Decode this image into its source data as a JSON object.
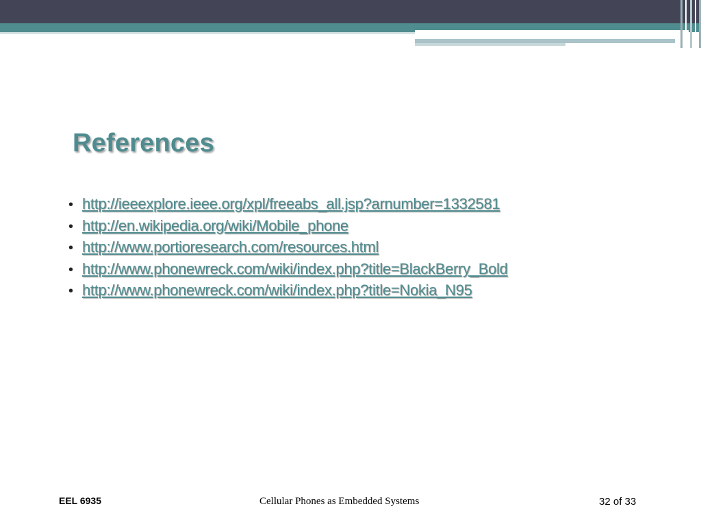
{
  "slide": {
    "title": "References",
    "references": [
      "http://ieeexplore.ieee.org/xpl/freeabs_all.jsp?arnumber=1332581",
      "http://en.wikipedia.org/wiki/Mobile_phone",
      "http://www.portioresearch.com/resources.html",
      "http://www.phonewreck.com/wiki/index.php?title=BlackBerry_Bold",
      "http://www.phonewreck.com/wiki/index.php?title=Nokia_N95"
    ],
    "bullet": "•"
  },
  "footer": {
    "course": "EEL 6935",
    "presentation_title": "Cellular Phones as Embedded Systems",
    "page_indicator": "32 of 33"
  },
  "colors": {
    "accent": "#4f8c8f",
    "banner_dark": "#434557",
    "banner_light": "#a9c3c8"
  }
}
